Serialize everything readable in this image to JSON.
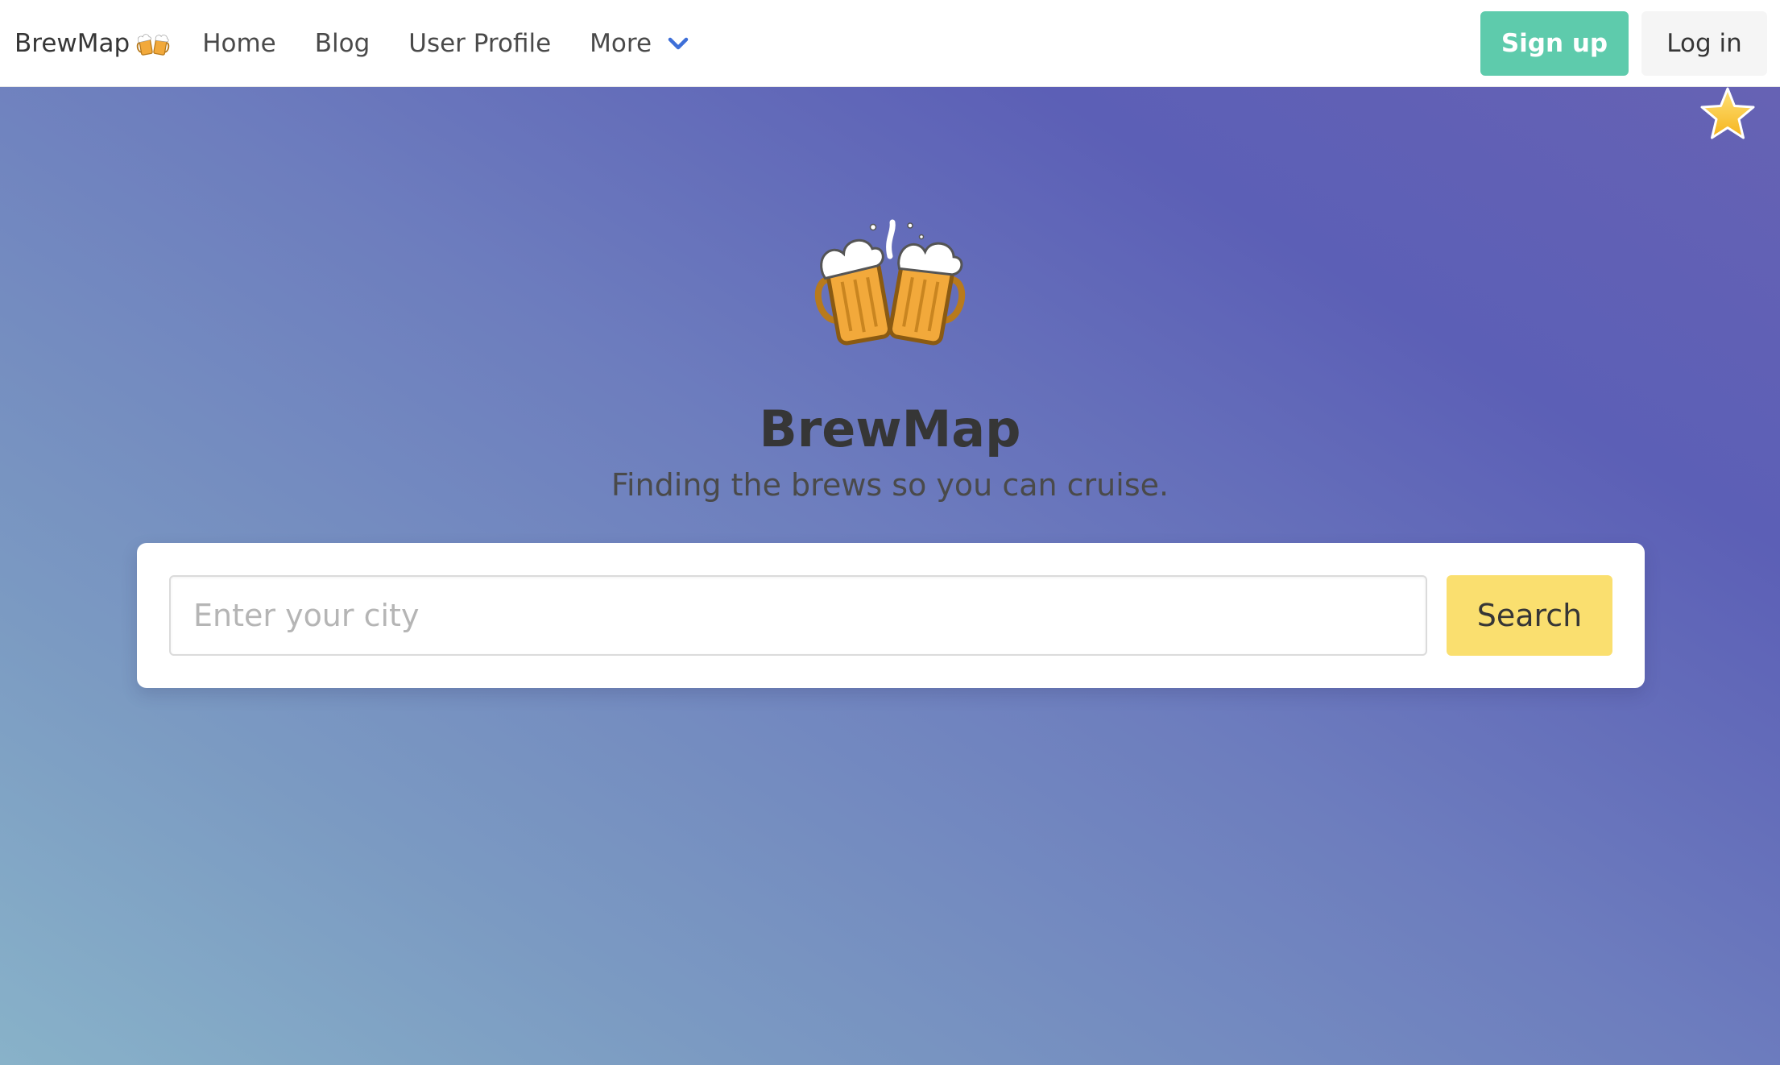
{
  "navbar": {
    "brand": "BrewMap",
    "brand_icon": "clinking-beer-mugs-icon",
    "items": [
      {
        "label": "Home"
      },
      {
        "label": "Blog"
      },
      {
        "label": "User Profile"
      },
      {
        "label": "More"
      }
    ],
    "more_icon": "chevron-down-icon",
    "signup_label": "Sign up",
    "login_label": "Log in"
  },
  "hero": {
    "logo_icon": "clinking-beer-mugs-icon",
    "star_icon": "star-icon",
    "title": "BrewMap",
    "subtitle": "Finding the brews so you can cruise."
  },
  "search": {
    "placeholder": "Enter your city",
    "value": "",
    "button_label": "Search"
  },
  "colors": {
    "primary": "#5ecbac",
    "warning": "#fadf6f",
    "link": "#3e6fd8",
    "beer": "#f2a93b"
  }
}
